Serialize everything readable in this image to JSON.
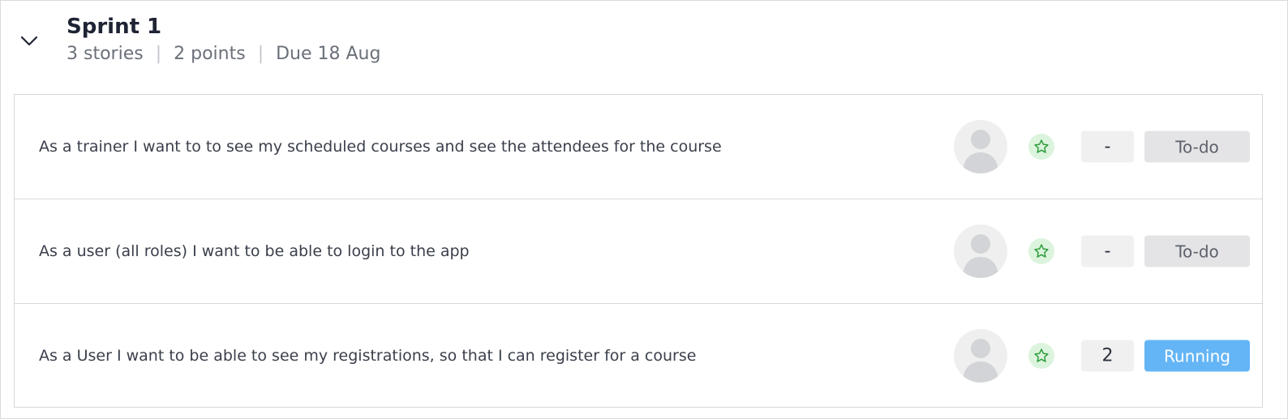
{
  "sprint": {
    "title": "Sprint 1",
    "stories_count": "3 stories",
    "points_total": "2 points",
    "due": "Due 18 Aug",
    "separator": "|"
  },
  "icons": {
    "collapse": "chevron-down-icon",
    "avatar": "user-avatar-icon",
    "star": "star-icon"
  },
  "colors": {
    "star_bg": "#dcf4dd",
    "star_stroke": "#2e9e3e",
    "running": "#64b5f6",
    "todo": "#e4e4e6"
  },
  "stories": [
    {
      "text": "As a trainer I want to to see my scheduled courses and see the attendees for the course",
      "points": "-",
      "status": "To-do",
      "status_type": "todo"
    },
    {
      "text": "As a user (all roles) I want to be able to login to the app",
      "points": "-",
      "status": "To-do",
      "status_type": "todo"
    },
    {
      "text": "As a User I want to be able to see my registrations, so that I can register for a course",
      "points": "2",
      "status": "Running",
      "status_type": "running"
    }
  ]
}
